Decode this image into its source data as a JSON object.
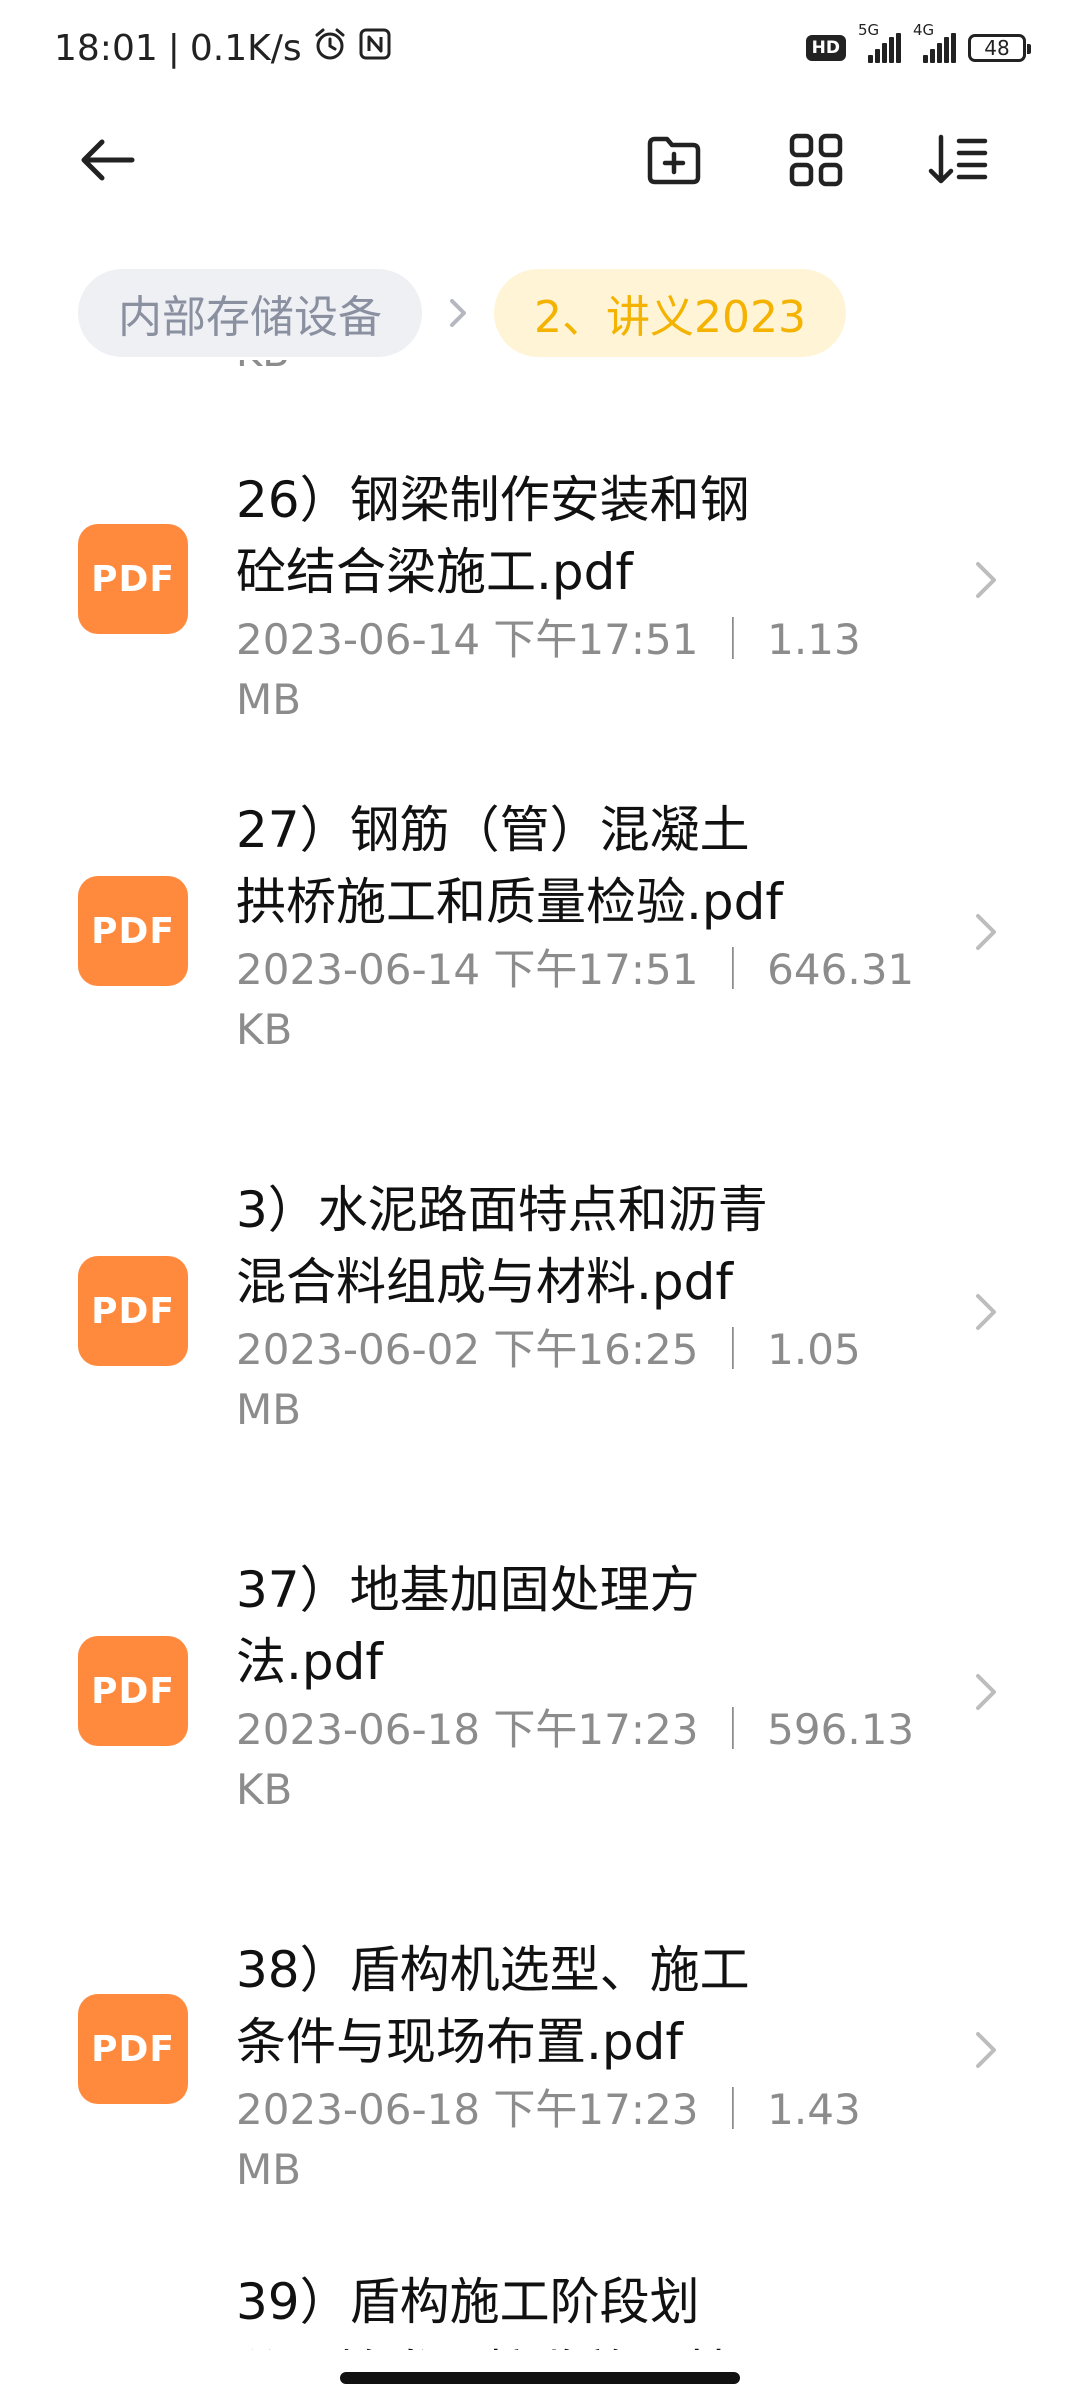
{
  "status_bar": {
    "time": "18:01",
    "separator": "|",
    "net_speed": "0.1K/s",
    "alarm_icon": "alarm-icon",
    "nfc_icon": "nfc-icon",
    "hd": "HD",
    "sig1_label": "5G",
    "sig2_label": "4G",
    "battery": "48"
  },
  "toolbar": {
    "back_icon": "back-arrow-icon",
    "new_folder_icon": "new-folder-icon",
    "grid_icon": "grid-view-icon",
    "sort_icon": "sort-icon"
  },
  "breadcrumb": {
    "root": "内部存储设备",
    "current": "2、讲义2023"
  },
  "list": {
    "partial_top_text": "KB",
    "items": [
      {
        "icon": "PDF",
        "title_line1": "26）钢梁制作安装和钢",
        "title_line2": "砼结合梁施工.pdf",
        "meta_line1": "2023-06-14 下午17:51 ｜ 1.13 MB",
        "meta_line2": ""
      },
      {
        "icon": "PDF",
        "title_line1": "27）钢筋（管）混凝土",
        "title_line2": "拱桥施工和质量检验.pdf",
        "meta_line1": "2023-06-14 下午17:51 ｜ 646.31",
        "meta_line2": "KB"
      },
      {
        "icon": "PDF",
        "title_line1": "3）水泥路面特点和沥青",
        "title_line2": "混合料组成与材料.pdf",
        "meta_line1": "2023-06-02 下午16:25 ｜ 1.05",
        "meta_line2": "MB"
      },
      {
        "icon": "PDF",
        "title_line1": "37）地基加固处理方",
        "title_line2": "法.pdf",
        "meta_line1": "2023-06-18 下午17:23 ｜ 596.13",
        "meta_line2": "KB"
      },
      {
        "icon": "PDF",
        "title_line1": "38）盾构机选型、施工",
        "title_line2": "条件与现场布置.pdf",
        "meta_line1": "2023-06-18 下午17:23 ｜ 1.43 MB",
        "meta_line2": ""
      },
      {
        "icon": "PDF",
        "title_line1": "39）盾构施工阶段划",
        "title_line2": "分及始发与接收施工技",
        "meta_line1": "",
        "meta_line2": ""
      }
    ]
  },
  "colors": {
    "pdf_icon_bg": "#ff8a3d",
    "breadcrumb_current_bg": "#fff4d6",
    "breadcrumb_current_text": "#f3b300",
    "breadcrumb_root_bg": "#eef0f4",
    "meta_text": "#8c8c8c"
  }
}
